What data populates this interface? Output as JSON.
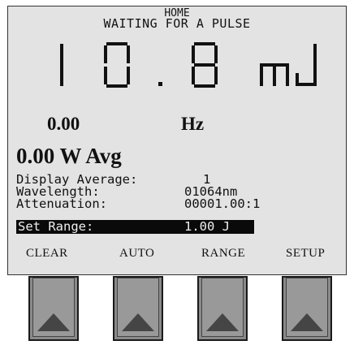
{
  "screen": {
    "header": "HOME",
    "status": "WAITING FOR A PULSE",
    "reading": {
      "value_chars": [
        "1",
        "0",
        ".",
        "8"
      ],
      "unit": "mJ"
    },
    "frequency": {
      "value": "0.00",
      "unit": "Hz"
    },
    "power": "0.00 W Avg",
    "info": [
      {
        "label": "Display Average:",
        "value": "1"
      },
      {
        "label": "Wavelength:",
        "value": "01064nm"
      },
      {
        "label": "Attenuation:",
        "value": "00001.00:1"
      }
    ],
    "selected": {
      "label": "Set Range:",
      "value": "1.00 J"
    },
    "softkeys": [
      "CLEAR",
      "AUTO",
      "RANGE",
      "SETUP"
    ]
  },
  "colors": {
    "screen_bg": "#e3e3e3",
    "button_face": "#8a8a8a",
    "arrow": "#454545",
    "highlight": "#0a0a0a"
  },
  "icons": [
    "up-arrow-icon"
  ]
}
